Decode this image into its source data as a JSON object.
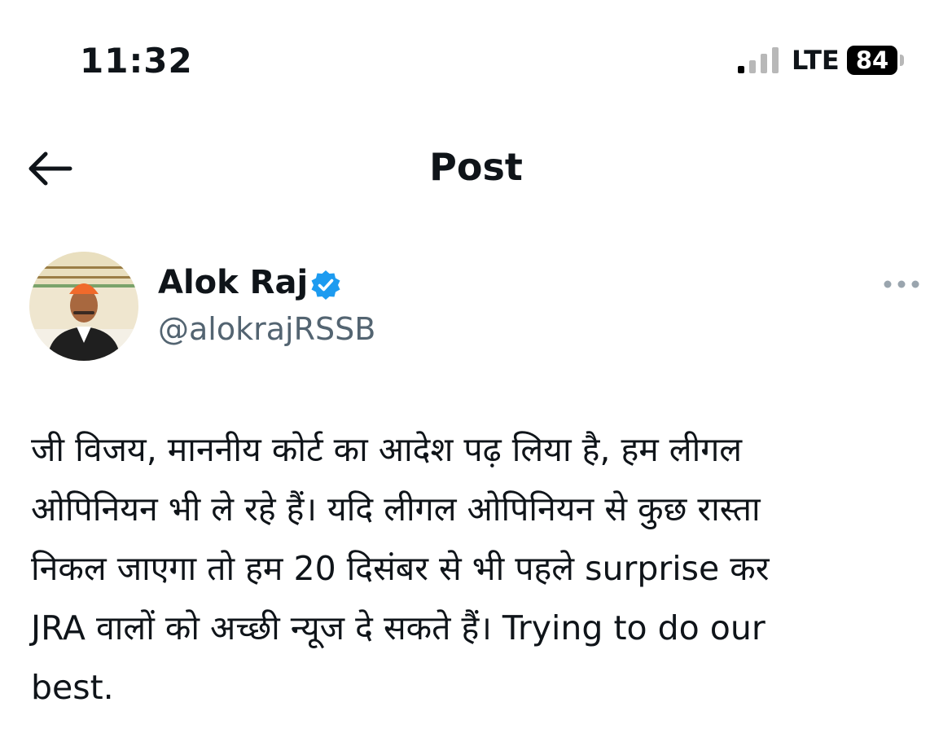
{
  "status_bar": {
    "time": "11:32",
    "network": "LTE",
    "battery_level": "84",
    "signal_bars_active": 1,
    "signal_bars_total": 4
  },
  "header": {
    "title": "Post",
    "back_icon": "arrow-left-icon"
  },
  "post": {
    "author": {
      "name": "Alok Raj",
      "handle": "@alokrajRSSB",
      "verified": true,
      "verified_color": "#1d9bf0"
    },
    "more_icon": "more-horizontal-icon",
    "text_lines": [
      "जी विजय, माननीय कोर्ट का आदेश पढ़ लिया है, हम लीगल",
      "ओपिनियन भी ले रहे हैं। यदि लीगल ओपिनियन से कुछ रास्ता",
      "निकल जाएगा  तो हम 20 दिसंबर से भी पहले surprise कर",
      "JRA वालों को अच्छी न्यूज दे सकते हैं। Trying to do our",
      "best."
    ]
  },
  "colors": {
    "text_primary": "#0f1419",
    "text_secondary": "#536471",
    "accent": "#1d9bf0",
    "background": "#ffffff"
  }
}
